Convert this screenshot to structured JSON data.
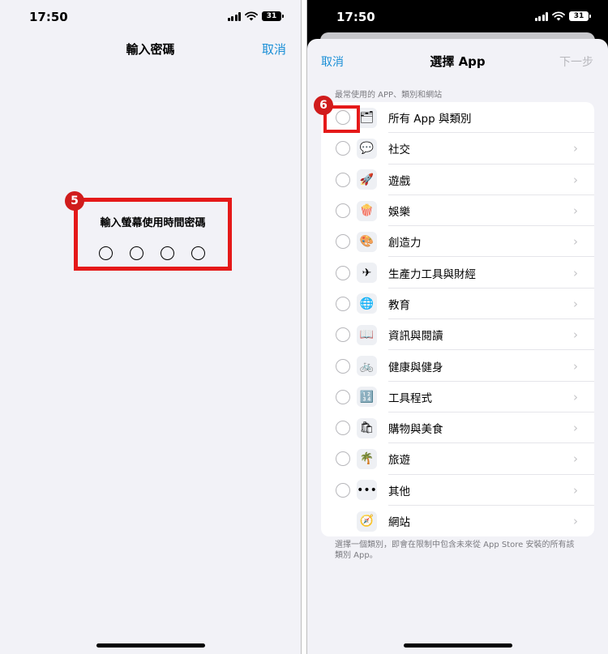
{
  "left": {
    "status": {
      "time": "17:50",
      "battery": "31"
    },
    "nav": {
      "title": "輸入密碼",
      "cancel": "取消"
    },
    "passcode": {
      "prompt": "輸入螢幕使用時間密碼",
      "digits": 4
    },
    "badge": "5"
  },
  "right": {
    "status": {
      "time": "17:50",
      "battery": "31"
    },
    "nav": {
      "cancel": "取消",
      "title": "選擇 App",
      "next": "下一步"
    },
    "section_header": "最常使用的 APP、類別和網站",
    "items": [
      {
        "label": "所有 App 與類別",
        "icon": "stack-icon",
        "glyph": "🗂",
        "radio": true,
        "chevron": false
      },
      {
        "label": "社交",
        "icon": "social-icon",
        "glyph": "💬",
        "radio": true,
        "chevron": true
      },
      {
        "label": "遊戲",
        "icon": "rocket-icon",
        "glyph": "🚀",
        "radio": true,
        "chevron": true
      },
      {
        "label": "娛樂",
        "icon": "popcorn-icon",
        "glyph": "🍿",
        "radio": true,
        "chevron": true
      },
      {
        "label": "創造力",
        "icon": "palette-icon",
        "glyph": "🎨",
        "radio": true,
        "chevron": true
      },
      {
        "label": "生產力工具與財經",
        "icon": "paper-plane-icon",
        "glyph": "✈",
        "radio": true,
        "chevron": true
      },
      {
        "label": "教育",
        "icon": "globe-icon",
        "glyph": "🌐",
        "radio": true,
        "chevron": true
      },
      {
        "label": "資訊與閱讀",
        "icon": "book-icon",
        "glyph": "📖",
        "radio": true,
        "chevron": true
      },
      {
        "label": "健康與健身",
        "icon": "bicycle-icon",
        "glyph": "🚲",
        "radio": true,
        "chevron": true
      },
      {
        "label": "工具程式",
        "icon": "calculator-icon",
        "glyph": "🔢",
        "radio": true,
        "chevron": true
      },
      {
        "label": "購物與美食",
        "icon": "shopping-bag-icon",
        "glyph": "🛍",
        "radio": true,
        "chevron": true
      },
      {
        "label": "旅遊",
        "icon": "palm-tree-icon",
        "glyph": "🌴",
        "radio": true,
        "chevron": true
      },
      {
        "label": "其他",
        "icon": "more-dots-icon",
        "glyph": "•••",
        "radio": true,
        "chevron": true
      },
      {
        "label": "網站",
        "icon": "compass-icon",
        "glyph": "🧭",
        "radio": false,
        "chevron": true
      }
    ],
    "footer": "選擇一個類別，即會在限制中包含未來從 App Store 安裝的所有該類別 App。",
    "badge": "6"
  },
  "colors": {
    "accent": "#1a8fd6",
    "highlight": "#e51919",
    "badge": "#d01c1c"
  }
}
